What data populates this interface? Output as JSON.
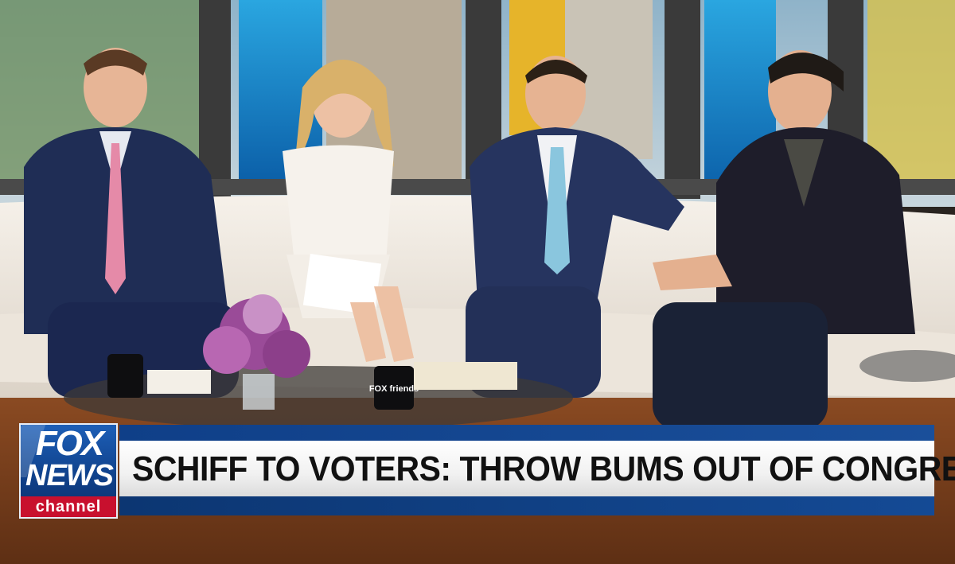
{
  "broadcast": {
    "network_logo": {
      "line1": "FOX",
      "line2": "NEWS",
      "line3": "channel"
    },
    "headline": "SCHIFF TO VOTERS: THROW BUMS OUT OF CONGRESS",
    "mug_logo": "FOX friends"
  },
  "colors": {
    "fox_blue": "#1d5fb7",
    "fox_red": "#c8102e",
    "banner_white": "#ffffff"
  }
}
